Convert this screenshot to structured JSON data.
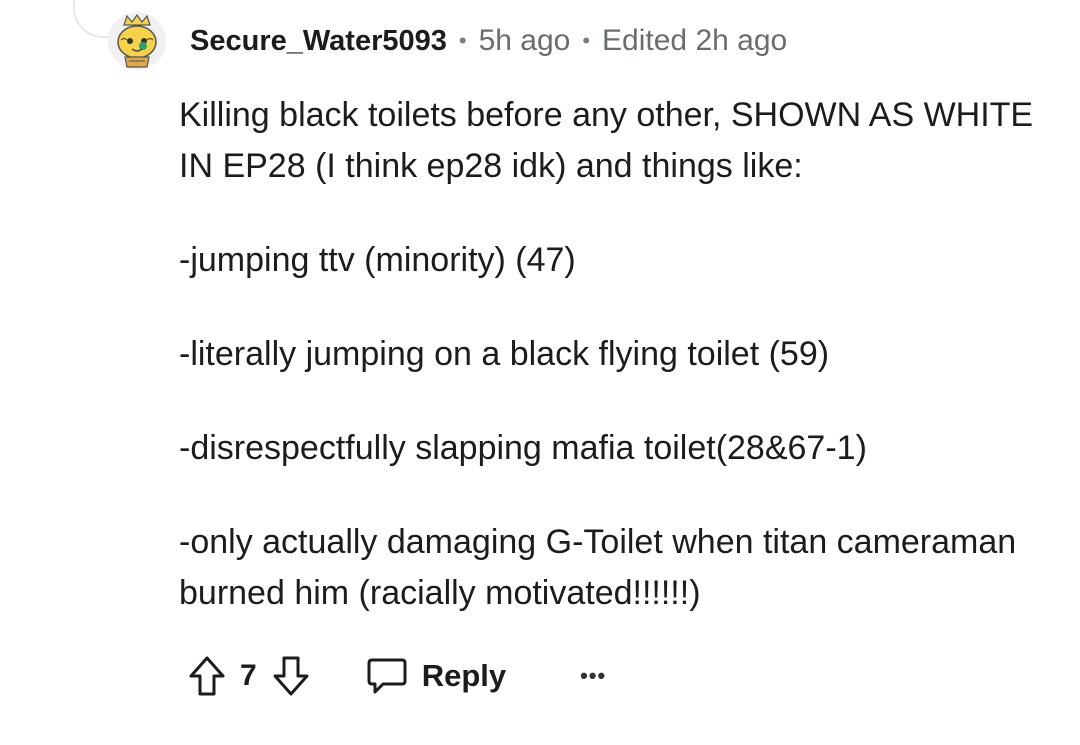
{
  "comment": {
    "username": "Secure_Water5093",
    "posted": "5h ago",
    "edited": "Edited 2h ago",
    "separator": "•",
    "paragraphs": [
      "Killing black toilets before any other, SHOWN AS WHITE IN EP28 (I think ep28 idk) and things like:",
      "-jumping ttv (minority) (47)",
      "-literally jumping on a black flying toilet (59)",
      "-disrespectfully slapping mafia toilet(28&67-1)",
      "-only actually damaging G-Toilet when titan cameraman burned him (racially motivated!!!!!!)"
    ]
  },
  "actions": {
    "upvote_icon": "upvote-arrow-icon",
    "vote_count": "7",
    "downvote_icon": "downvote-arrow-icon",
    "reply_icon": "speech-bubble-icon",
    "reply_label": "Reply",
    "more_label": "•••"
  },
  "avatar": {
    "icon": "snoo-avatar-icon",
    "colors": {
      "skin": "#f5d24a",
      "accent": "#2e9e6b",
      "outline": "#555555"
    }
  }
}
